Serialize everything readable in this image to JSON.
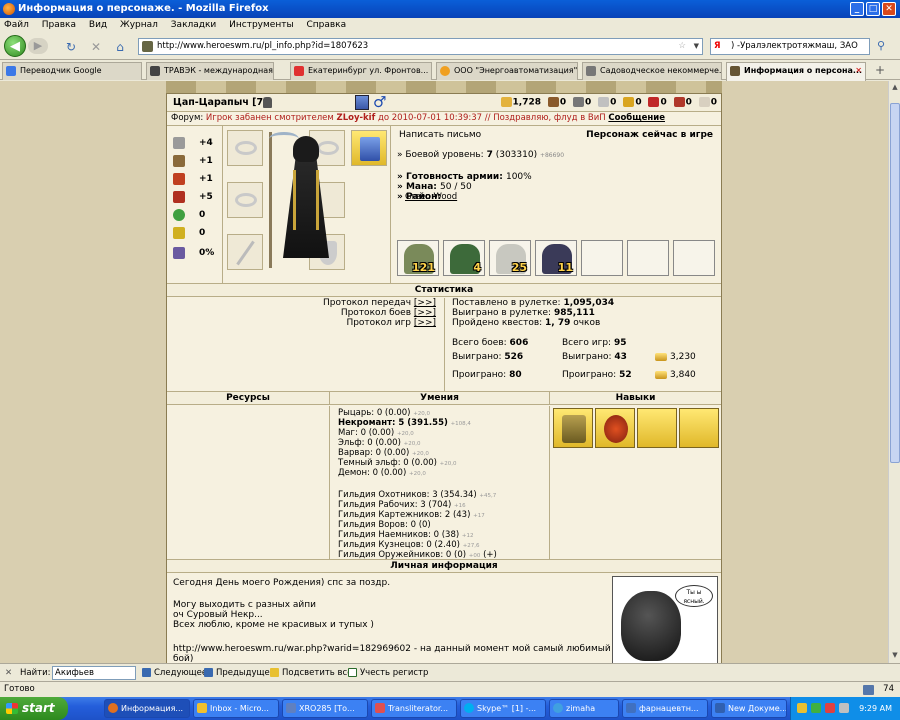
{
  "window": {
    "title": "Информация о персонаже. - Mozilla Firefox"
  },
  "menu": [
    "Файл",
    "Правка",
    "Вид",
    "Журнал",
    "Закладки",
    "Инструменты",
    "Справка"
  ],
  "nav": {
    "url": "http://www.heroeswm.ru/pl_info.php?id=1807623",
    "search_value": ") -Уралэлектротяжмаш, ЗАО"
  },
  "tabs": [
    {
      "label": "Переводчик Google",
      "color": "#3b78e7"
    },
    {
      "label": "ТРАВЭК - международная а...",
      "color": "#444444"
    },
    {
      "label": "Екатеринбург ул. Фронтов...",
      "color": "#e03030"
    },
    {
      "label": "ООО \"Энергоавтоматизация\"",
      "color": "#f0a020"
    },
    {
      "label": "Садоводческое некоммерче...",
      "color": "#777777"
    },
    {
      "label": "Информация о персона...",
      "color": "#665533"
    }
  ],
  "player": {
    "name": "Цап-Царапыч",
    "level": "[7]",
    "resources": [
      {
        "icon": "gold-icon",
        "value": "1,728",
        "color": "#e3b23c"
      },
      {
        "icon": "wood-icon",
        "value": "0",
        "color": "#8a5a2b"
      },
      {
        "icon": "ore-icon",
        "value": "0",
        "color": "#777777"
      },
      {
        "icon": "mercury-icon",
        "value": "0",
        "color": "#c0c0c0"
      },
      {
        "icon": "sulfur-icon",
        "value": "0",
        "color": "#d9a520"
      },
      {
        "icon": "crystal-icon",
        "value": "0",
        "color": "#c02828"
      },
      {
        "icon": "gems-icon",
        "value": "0",
        "color": "#b0382a"
      },
      {
        "icon": "diamond-icon",
        "value": "0",
        "color": "#d8d0c0"
      }
    ]
  },
  "forum": {
    "prefix": "Форум: ",
    "ban_text": "Игрок забанен смотрителем ",
    "moderator": "ZLoy-kif",
    "until": " до 2010-07-01 10:39:37 // ",
    "note": "Поздравляю, флуд в ВиП ",
    "link": "Сообщение"
  },
  "stats": [
    {
      "icon": "attack-icon",
      "value": "+4",
      "color": "#9a9a9a"
    },
    {
      "icon": "defense-icon",
      "value": "+1",
      "color": "#8a6a3a"
    },
    {
      "icon": "spellpower-icon",
      "value": "+1",
      "color": "#c04020"
    },
    {
      "icon": "knowledge-icon",
      "value": "+5",
      "color": "#b03020"
    },
    {
      "icon": "luck-icon",
      "value": "0",
      "color": "#40a040"
    },
    {
      "icon": "morale-icon",
      "value": "0",
      "color": "#d0b020"
    },
    {
      "icon": "initiative-icon",
      "value": "0%",
      "color": "#6a5aa0"
    }
  ],
  "info": {
    "write_letter": "Написать письмо",
    "online": "Персонаж сейчас в игре",
    "combat_label": "» Боевой уровень: ",
    "combat_value": "7",
    "combat_xp": " (303310) ",
    "combat_next": "+86690",
    "army_label": "» Готовность армии: ",
    "army_value": "100%",
    "mana_label": "» Мана: ",
    "mana_value": "50 / 50",
    "district_label": "» Район: ",
    "district_value": "Green Wood"
  },
  "army": [
    {
      "count": "121",
      "color": "#7a8a5a"
    },
    {
      "count": "4",
      "color": "#3d6a3a"
    },
    {
      "count": "25",
      "color": "#c8c8c0"
    },
    {
      "count": "11",
      "color": "#3a3a58"
    },
    {
      "count": "",
      "color": "transparent"
    },
    {
      "count": "",
      "color": "transparent"
    },
    {
      "count": "",
      "color": "transparent"
    }
  ],
  "statistics": {
    "header": "Статистика",
    "protocols": [
      {
        "label": "Протокол передач ",
        "link": "[>>]"
      },
      {
        "label": "Протокол боев ",
        "link": "[>>]"
      },
      {
        "label": "Протокол игр ",
        "link": "[>>]"
      }
    ],
    "roulette_bet_label": "Поставлено в рулетке: ",
    "roulette_bet": "1,095,034",
    "roulette_won_label": "Выиграно в рулетке: ",
    "roulette_won": "985,111",
    "quests_label": "Пройдено квестов: ",
    "quests_value": "1, 79",
    "quests_suffix": " очков",
    "battles_label": "Всего боев: ",
    "battles": "606",
    "games_label": "Всего игр: ",
    "games": "95",
    "won_label": "Выиграно: ",
    "battles_won": "526",
    "games_won": "43",
    "gold_won": "3,230",
    "lost_label": "Проиграно: ",
    "battles_lost": "80",
    "games_lost": "52",
    "gold_lost": "3,840"
  },
  "skills": {
    "resources_header": "Ресурсы",
    "skills_header": "Умения",
    "talents_header": "Навыки",
    "factions": [
      {
        "name": "Рыцарь: ",
        "value": "0 (0.00)",
        "next": "+20,0",
        "bold": false
      },
      {
        "name": "Некромант: ",
        "value": "5 (391.55)",
        "next": "+108,4",
        "bold": true
      },
      {
        "name": "Маг: ",
        "value": "0 (0.00)",
        "next": "+20,0",
        "bold": false
      },
      {
        "name": "Эльф: ",
        "value": "0 (0.00)",
        "next": "+20,0",
        "bold": false
      },
      {
        "name": "Варвар: ",
        "value": "0 (0.00)",
        "next": "+20,0",
        "bold": false
      },
      {
        "name": "Темный эльф: ",
        "value": "0 (0.00)",
        "next": "+20,0",
        "bold": false
      },
      {
        "name": "Демон: ",
        "value": "0 (0.00)",
        "next": "+20,0",
        "bold": false
      }
    ],
    "guilds": [
      {
        "name": "Гильдия Охотников: ",
        "value": "3 (354.34)",
        "next": "+45,7"
      },
      {
        "name": "Гильдия Рабочих: ",
        "value": "3 (704)",
        "next": "+16"
      },
      {
        "name": "Гильдия Картежников: ",
        "value": "2 (43)",
        "next": "+17"
      },
      {
        "name": "Гильдия Воров: ",
        "value": "0 (0)",
        "next": ""
      },
      {
        "name": "Гильдия Наемников: ",
        "value": "0 (38)",
        "next": "+12"
      },
      {
        "name": "Гильдия Кузнецов: ",
        "value": "0 (2.40)",
        "next": "+27,6"
      },
      {
        "name": "Гильдия Оружейников: ",
        "value": "0 (0)",
        "next": "+00"
      }
    ],
    "expand": "(+)"
  },
  "personal": {
    "header": "Личная информация",
    "lines": [
      "Сегодня День моего Рождения) спс за поздр.",
      "",
      "Могу выходить с разных айпи",
      "оч Суровый Некр...",
      "Всех люблю, кроме не красивых и тупых )",
      "",
      "",
      "http://www.heroeswm.ru/war.php?warid=182969602 - на данный момент мой самый любимый",
      "бой)"
    ],
    "bubble": "Ты ы ясный."
  },
  "find": {
    "label": "Найти:",
    "value": "Акифьев",
    "next": "Следующее",
    "prev": "Предыдущее",
    "highlight": "Подсветить все",
    "case": "Учесть регистр"
  },
  "status": {
    "text": "Готово",
    "zoom": "74"
  },
  "taskbar": {
    "start": "start",
    "items": [
      {
        "label": "Информация...",
        "color": "#e07020"
      },
      {
        "label": "Inbox - Micro...",
        "color": "#f0c030"
      },
      {
        "label": "XRO285 [То...",
        "color": "#6080c0"
      },
      {
        "label": "Transliterator...",
        "color": "#e05050"
      },
      {
        "label": "Skype™ [1] -...",
        "color": "#00aff0"
      },
      {
        "label": "zimaha",
        "color": "#40a0e0"
      },
      {
        "label": "фарнацевтн...",
        "color": "#4070c0"
      },
      {
        "label": "New Докуме...",
        "color": "#3060b0"
      }
    ],
    "clock": "9:29 AM"
  }
}
